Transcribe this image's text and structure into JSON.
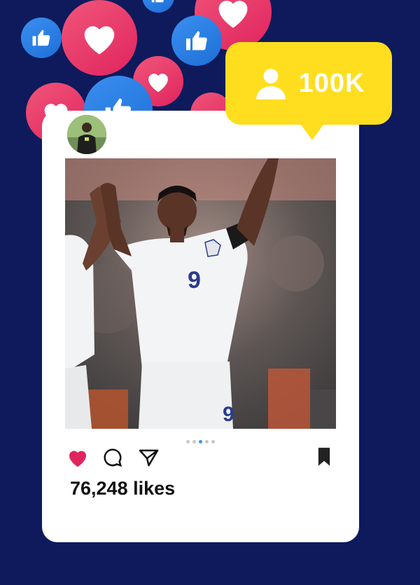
{
  "follower_badge": {
    "count": "100K",
    "icon": "user-icon"
  },
  "post": {
    "avatar_icon": "avatar",
    "photo": {
      "description_icon": "photo",
      "jersey_number": "9"
    },
    "carousel": {
      "total": 5,
      "active": 3
    },
    "actions": {
      "like_icon": "heart-icon",
      "comment_icon": "comment-icon",
      "share_icon": "send-icon",
      "save_icon": "bookmark-icon"
    },
    "likes": "76,248 likes"
  },
  "colors": {
    "background": "#0e1a5c",
    "heart": "#e0245e",
    "like": "#1d6fd6",
    "badge": "#ffde1f",
    "liked": "#e0245e"
  }
}
